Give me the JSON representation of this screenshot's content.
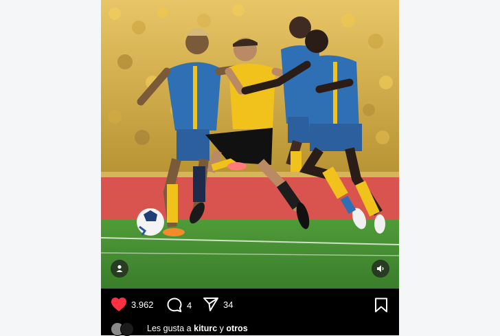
{
  "post": {
    "likes_count": "3.962",
    "comments_count": "4",
    "shares_count": "34",
    "likes_prefix": "Les gusta a",
    "likes_user": "kiturc",
    "likes_joiner": "y",
    "likes_others": "otros"
  },
  "icons": {
    "like": "heart-icon",
    "comment": "comment-bubble-icon",
    "share": "send-icon",
    "save": "bookmark-icon",
    "user_tag": "user-icon",
    "audio": "speaker-icon"
  },
  "colors": {
    "like_red": "#ff3040",
    "action_bar": "#000000",
    "pitch_green": "#3f8e2f",
    "home_yellow": "#f1c21b",
    "away_blue": "#2f6fb3"
  }
}
